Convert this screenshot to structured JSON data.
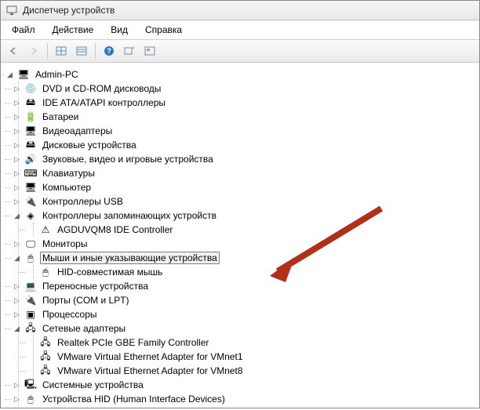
{
  "window": {
    "title": "Диспетчер устройств"
  },
  "menu": {
    "file": "Файл",
    "action": "Действие",
    "view": "Вид",
    "help": "Справка"
  },
  "tree": {
    "root": "Admin-PC",
    "items": [
      {
        "icon": "💿",
        "label": "DVD и CD-ROM дисководы"
      },
      {
        "icon": "🖴",
        "label": "IDE ATA/ATAPI контроллеры"
      },
      {
        "icon": "🔋",
        "label": "Батареи"
      },
      {
        "icon": "🖥",
        "label": "Видеоадаптеры"
      },
      {
        "icon": "🖴",
        "label": "Дисковые устройства"
      },
      {
        "icon": "🔊",
        "label": "Звуковые, видео и игровые устройства"
      },
      {
        "icon": "⌨",
        "label": "Клавиатуры"
      },
      {
        "icon": "🖥",
        "label": "Компьютер"
      },
      {
        "icon": "🔌",
        "label": "Контроллеры USB"
      },
      {
        "icon": "◈",
        "label": "Контроллеры запоминающих устройств",
        "expanded": true,
        "children": [
          {
            "icon": "⚠",
            "label": "AGDUVQM8 IDE Controller"
          }
        ]
      },
      {
        "icon": "🖵",
        "label": "Мониторы"
      },
      {
        "icon": "🖱",
        "label": "Мыши и иные указывающие устройства",
        "expanded": true,
        "selected": true,
        "children": [
          {
            "icon": "🖱",
            "label": "HID-совместимая мышь"
          }
        ]
      },
      {
        "icon": "💻",
        "label": "Переносные устройства"
      },
      {
        "icon": "🔌",
        "label": "Порты (COM и LPT)"
      },
      {
        "icon": "▣",
        "label": "Процессоры"
      },
      {
        "icon": "🖧",
        "label": "Сетевые адаптеры",
        "expanded": true,
        "children": [
          {
            "icon": "🖧",
            "label": "Realtek PCIe GBE Family Controller"
          },
          {
            "icon": "🖧",
            "label": "VMware Virtual Ethernet Adapter for VMnet1"
          },
          {
            "icon": "🖧",
            "label": "VMware Virtual Ethernet Adapter for VMnet8"
          }
        ]
      },
      {
        "icon": "🖳",
        "label": "Системные устройства"
      },
      {
        "icon": "🖱",
        "label": "Устройства HID (Human Interface Devices)"
      }
    ]
  }
}
